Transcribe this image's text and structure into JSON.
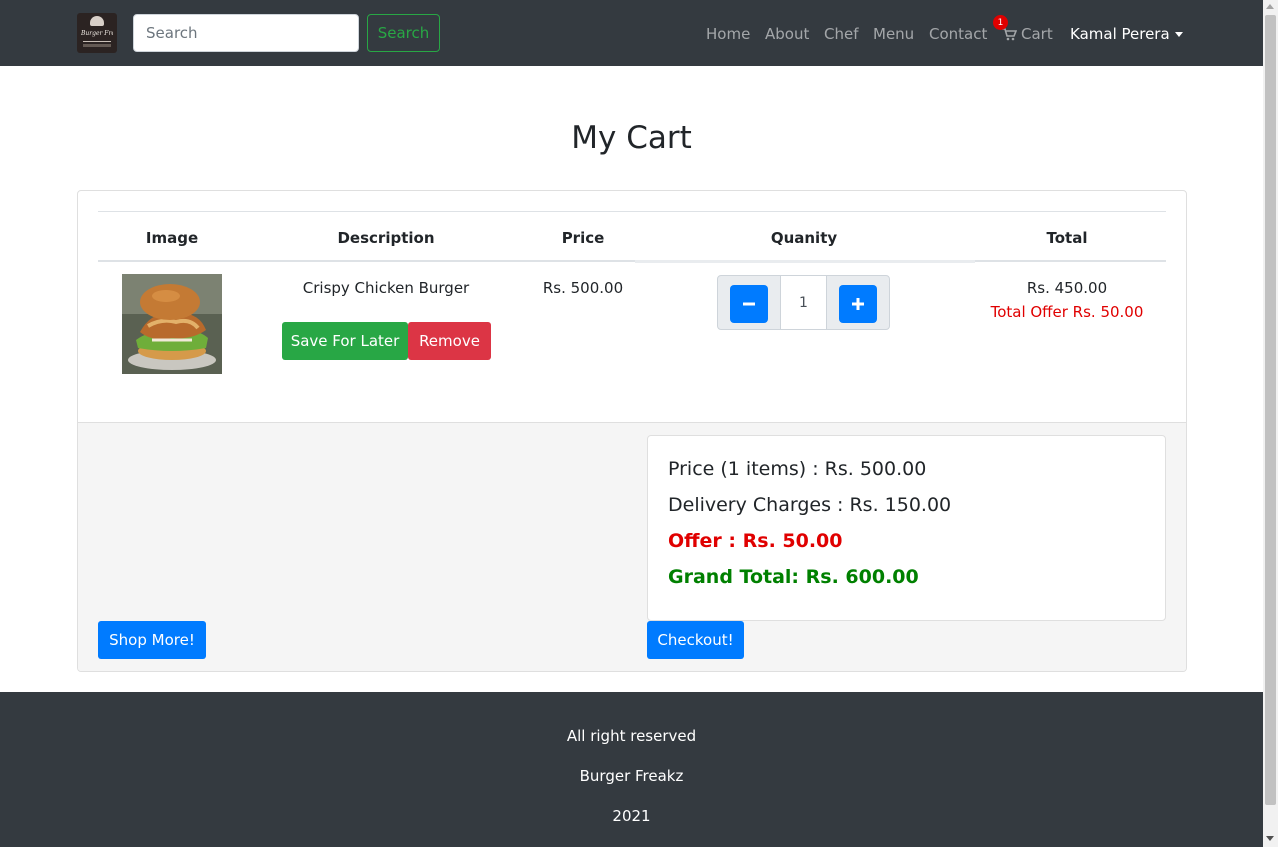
{
  "navbar": {
    "logo_text": "Burger Freakz",
    "search_placeholder": "Search",
    "search_button": "Search",
    "links": [
      "Home",
      "About",
      "Chef",
      "Menu",
      "Contact"
    ],
    "cart_label": "Cart",
    "cart_count": "1",
    "user_name": "Kamal Perera"
  },
  "page": {
    "title": "My Cart"
  },
  "cart_table": {
    "headers": [
      "Image",
      "Description",
      "Price",
      "Quanity",
      "Total"
    ],
    "items": [
      {
        "image": "crispy-chicken-burger-photo",
        "description": "Crispy Chicken Burger",
        "price": "Rs. 500.00",
        "quantity": "1",
        "total": "Rs. 450.00",
        "offer": "Total Offer Rs. 50.00",
        "save_label": "Save For Later",
        "remove_label": "Remove"
      }
    ]
  },
  "summary": {
    "price_line": "Price (1 items) : Rs. 500.00",
    "delivery_line": "Delivery Charges : Rs. 150.00",
    "offer_line": "Offer : Rs. 50.00",
    "grand_total_line": "Grand Total: Rs. 600.00"
  },
  "actions": {
    "shop_more": "Shop More!",
    "checkout": "Checkout!"
  },
  "footer": {
    "line1": "All right reserved",
    "line2": "Burger Freakz",
    "line3": "2021"
  },
  "colors": {
    "navbar": "#343a40",
    "primary": "#007bff",
    "success": "#28a745",
    "danger": "#dc3545",
    "offer_red": "#e00000",
    "grand_green": "#008000"
  }
}
